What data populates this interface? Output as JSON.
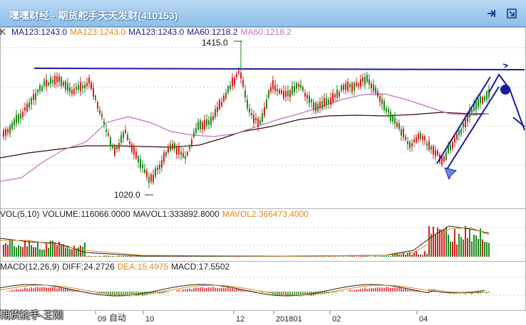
{
  "window": {
    "title": "嘿嘿财经 - 期货舵手天天发财(410153)"
  },
  "legend_price": {
    "k_label": "K",
    "items": [
      {
        "text": "MA123:1243.0",
        "color": "#1a1a8c"
      },
      {
        "text": "MA123:1243.0",
        "color": "#e08a1a"
      },
      {
        "text": "MA123:1243.0",
        "color": "#1a1a8c"
      },
      {
        "text": "MA60:1218.2",
        "color": "#1a1a8c"
      },
      {
        "text": "MA60:1218.2",
        "color": "#c070c0"
      }
    ]
  },
  "legend_vol": {
    "items": [
      {
        "text": "VOL(5,10)",
        "color": "#222222"
      },
      {
        "text": "VOLUME:116066.0000",
        "color": "#222222"
      },
      {
        "text": "MAVOL1:333892.8000",
        "color": "#222222"
      },
      {
        "text": "MAVOL2:366473.4000",
        "color": "#e08a1a"
      }
    ]
  },
  "legend_macd": {
    "items": [
      {
        "text": "MACD(12,26,9)",
        "color": "#222222"
      },
      {
        "text": "DIFF:24.2726",
        "color": "#222222"
      },
      {
        "text": "DEA:15.4975",
        "color": "#e08a1a"
      },
      {
        "text": "MACD:17.5502",
        "color": "#222222"
      }
    ]
  },
  "price_annotations": {
    "high": "1415.0",
    "low": "1020.0"
  },
  "x_axis_labels": [
    "09",
    "10",
    "12",
    "201801",
    "02",
    "04"
  ],
  "bottom": {
    "watermark": "期货舵手-王刚",
    "auto": "自动"
  },
  "colors": {
    "up": "#d42020",
    "down": "#1f8a1f",
    "ma_long": "#3a0a0a",
    "ma60": "#c070c0",
    "trendline": "#1a1aa0",
    "grid": "#c8c8c8"
  },
  "icons": {
    "pin": "pin-icon",
    "restore": "restore-icon"
  },
  "chart_data": {
    "type": "candlestick",
    "price_marks": {
      "high": 1415.0,
      "low": 1020.0
    },
    "indicators": {
      "MA123": 1243.0,
      "MA60": 1218.2,
      "VOLUME": 116066.0,
      "MAVOL1": 333892.8,
      "MAVOL2": 366473.4,
      "DIFF": 24.2726,
      "DEA": 15.4975,
      "MACD": 17.5502
    },
    "x_labels": [
      "09",
      "10",
      "12",
      "201801",
      "02",
      "04"
    ]
  }
}
